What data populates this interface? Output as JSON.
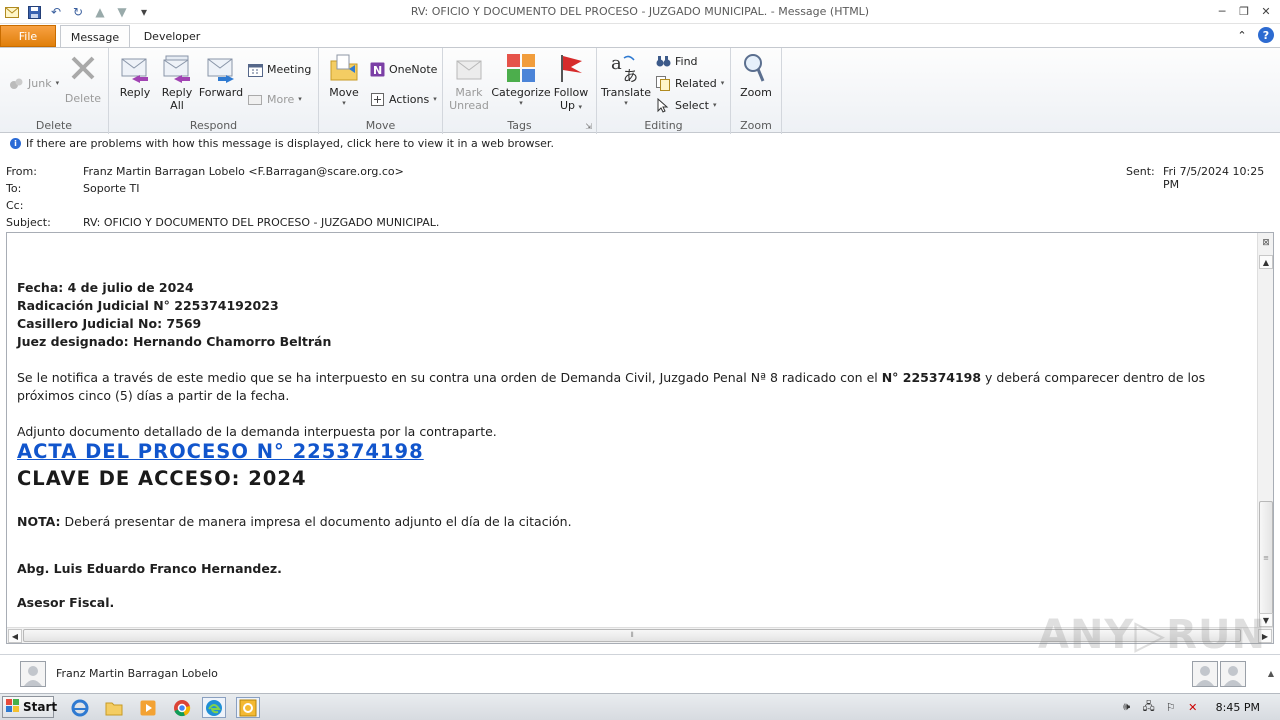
{
  "window": {
    "title": "RV: OFICIO Y DOCUMENTO DEL PROCESO - JUZGADO MUNICIPAL.  -  Message (HTML)"
  },
  "ribbon_tabs": {
    "file": "File",
    "message": "Message",
    "developer": "Developer"
  },
  "ribbon": {
    "delete_group": {
      "label": "Delete",
      "junk": "Junk",
      "delete": "Delete"
    },
    "respond_group": {
      "label": "Respond",
      "reply": "Reply",
      "reply_all_1": "Reply",
      "reply_all_2": "All",
      "forward": "Forward",
      "meeting": "Meeting",
      "more": "More"
    },
    "move_group": {
      "label": "Move",
      "move": "Move",
      "onenote": "OneNote",
      "actions": "Actions"
    },
    "tags_group": {
      "label": "Tags",
      "mark_unread_1": "Mark",
      "mark_unread_2": "Unread",
      "categorize": "Categorize",
      "follow_up_1": "Follow",
      "follow_up_2": "Up"
    },
    "editing_group": {
      "label": "Editing",
      "translate": "Translate",
      "find": "Find",
      "related": "Related",
      "select": "Select"
    },
    "zoom_group": {
      "label": "Zoom",
      "zoom": "Zoom"
    }
  },
  "infobar": {
    "text": "If there are problems with how this message is displayed, click here to view it in a web browser."
  },
  "header": {
    "from_label": "From:",
    "from_value": "Franz Martin Barragan Lobelo <F.Barragan@scare.org.co>",
    "to_label": "To:",
    "to_value": "Soporte TI",
    "cc_label": "Cc:",
    "subject_label": "Subject:",
    "subject_value": "RV: OFICIO Y DOCUMENTO DEL PROCESO - JUZGADO MUNICIPAL.",
    "sent_label": "Sent:",
    "sent_value": "Fri 7/5/2024 10:25 PM"
  },
  "body": {
    "line1": "Fecha: 4 de julio de 2024",
    "line2": "Radicación Judicial N° 225374192023",
    "line3": "Casillero Judicial No: 7569",
    "line4": "Juez designado: Hernando Chamorro Beltrán",
    "notice_part1": "Se le notifica a través de este medio que se ha interpuesto en su contra una orden de Demanda Civil, Juzgado Penal Nª 8 radicado con el ",
    "notice_bold": "N° 225374198",
    "notice_part2": " y deberá comparecer dentro de los próximos cinco (5) días a partir de la fecha.",
    "attach_text": "Adjunto documento detallado de la demanda interpuesta por la contraparte.",
    "link_text": "ACTA DEL PROCESO N° 225374198",
    "password_text": "CLAVE DE ACCESO: 2024",
    "nota_label": "NOTA:",
    "nota_text": "  Deberá presentar de manera impresa el documento adjunto el día de la citación.",
    "signature_name": "Abg. Luis Eduardo Franco Hernandez.",
    "signature_title": "Asesor Fiscal."
  },
  "people_pane": {
    "name": "Franz Martin Barragan Lobelo"
  },
  "taskbar": {
    "start": "Start",
    "clock": "8:45 PM"
  },
  "watermark": "ANY▷RUN"
}
